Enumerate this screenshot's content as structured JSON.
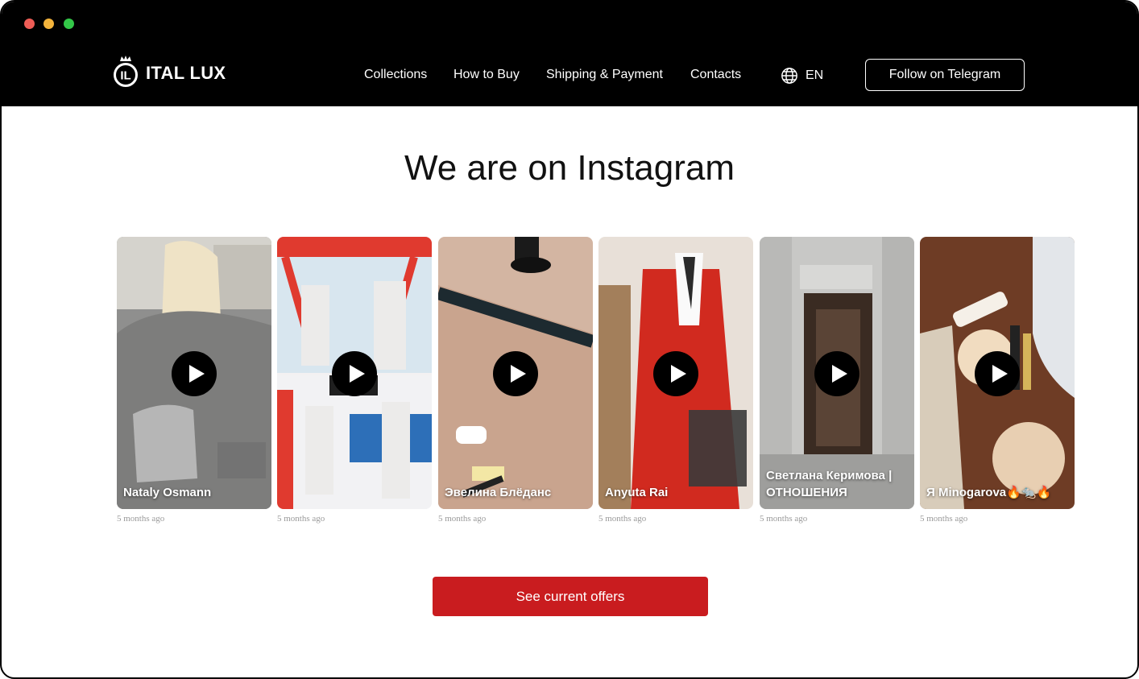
{
  "window": {
    "controls": [
      "close",
      "minimize",
      "maximize"
    ]
  },
  "header": {
    "logo_text": "ITAL LUX",
    "logo_mark": "IL",
    "nav": [
      {
        "label": "Collections"
      },
      {
        "label": "How to Buy"
      },
      {
        "label": "Shipping & Payment"
      },
      {
        "label": "Contacts"
      }
    ],
    "language": {
      "icon": "globe-icon",
      "label": "EN"
    },
    "follow_button": "Follow on Telegram"
  },
  "main": {
    "title": "We are on Instagram",
    "posts": [
      {
        "author": "Nataly Osmann",
        "time": "5 months ago",
        "icon": "play-icon"
      },
      {
        "author": "",
        "time": "5 months ago",
        "icon": "play-icon"
      },
      {
        "author": "Эвелина Блёданс",
        "time": "5 months ago",
        "icon": "play-icon"
      },
      {
        "author": "Anyuta Rai",
        "time": "5 months ago",
        "icon": "play-icon"
      },
      {
        "author": "Светлана Керимова | ОТНОШЕНИЯ",
        "time": "5 months ago",
        "icon": "play-icon"
      },
      {
        "author": "Я Minogarova🔥🐀🔥",
        "time": "5 months ago",
        "icon": "play-icon"
      }
    ],
    "cta_button": "See current offers"
  },
  "colors": {
    "accent": "#c91c1f",
    "header_bg": "#000000",
    "text": "#111111",
    "muted": "#9a9a9a"
  }
}
